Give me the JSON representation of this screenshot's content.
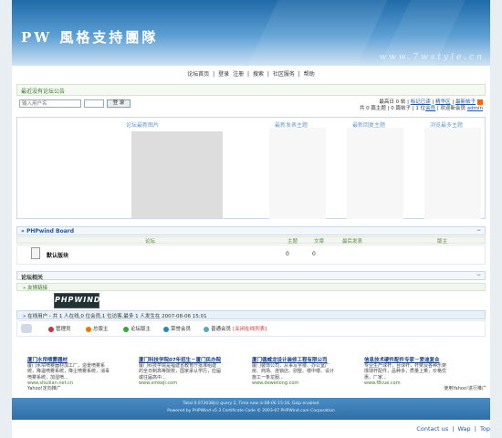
{
  "header": {
    "logo": "PW 風格支持團隊",
    "watermark": "www.7wstyle.cn"
  },
  "nav": {
    "items": [
      "论坛首页",
      "登录",
      "注册",
      "搜索",
      "社区服务",
      "帮助"
    ],
    "sep": "|"
  },
  "notice": {
    "text": "最近没有论坛公告"
  },
  "login": {
    "username_placeholder": "输入用户名",
    "button": "登 录"
  },
  "stats": {
    "line1": {
      "today": "最高日 0 帖",
      "mark_read": "标记已读",
      "top": "精华区",
      "new": "最新帖子"
    },
    "line2": {
      "prefix": "共 0 篇主题 | 0 篇帖子 | 1 位",
      "members": "会员",
      "welcome": "| 欢迎新会员",
      "newest": "admin"
    }
  },
  "tabs": {
    "images": "论坛最新图片",
    "latest_topics": "最新发表主题",
    "latest_replies": "最新回复主题",
    "hot": "浏览最多主题"
  },
  "board": {
    "title": "» PHPwind Board",
    "columns": {
      "forum": "论坛",
      "topics": "主题",
      "posts": "文章",
      "last": "最后发表",
      "mods": "版主"
    },
    "forums": [
      {
        "name": "默认版块",
        "topics": "0",
        "posts": "0"
      }
    ]
  },
  "related": {
    "title": "论坛相关",
    "links_label": "» 友情链接",
    "pw_logo": "PHPWIND"
  },
  "online": {
    "text": "» 在线用户 - 共 1 人在线,0 位会员,1 位访客,最多 1 人发生在 2007-08-06 15:01",
    "legend": [
      "管理员",
      "总版主",
      "论坛版主",
      "荣誉会员",
      "普通会员"
    ],
    "toggle": "[关闭在线列表]"
  },
  "ads": [
    {
      "title": "厦门水帘喷雾器材",
      "lines": [
        "厦门水帘喷雾器材加工厂，造景喷雾系",
        "统，降温喷雾系统，降尘喷雾系统，消毒",
        "喷雾系统，加湿喷..."
      ],
      "url": "www.shuilian.net.cn"
    },
    {
      "title": "厦门科技学院07年招生－厦门民办院",
      "lines": [
        "厦门科技学院是福建省教育厅批准组建",
        "的全日制高等院校，国家承认学历，应届",
        "或往届高中..."
      ],
      "url": "www.xmkeji.com"
    },
    {
      "title": "厦门德威龙设计装修工程有限公司",
      "lines": [
        "厦门装饰公司，从事写字楼、办公室厂",
        "房、商场、连锁店、别墅、楼中楼、设计",
        "施工一条龙服..."
      ],
      "url": "www.deweilong.com"
    },
    {
      "title": "信息技术硬件配件专家－爱迪复合",
      "lines": [
        "专业生产球杆，台球杆，杆架及各种乐架",
        "撞球杆配件，品种多，质量上乘，价格优",
        "惠，厂家..."
      ],
      "url": "www.f8cue.com"
    }
  ],
  "ads_extra": {
    "left": "Yahoo!定向推广",
    "right": "使用Yahoo!进行推广"
  },
  "footer": {
    "line1": "Total 0.073038(s) query 2, Time now is:08-06 15:16, Gzip enabled",
    "line2": "Powered by PHPWind v5.3 Certificate Code © 2003-07 PHPWind.com Corporation"
  },
  "bottom_links": [
    "Contact us",
    "Wap",
    "Top"
  ],
  "colors": {
    "header": "#2f6fa8",
    "accent": "#1a55a8",
    "green": "#3a7a2a"
  }
}
